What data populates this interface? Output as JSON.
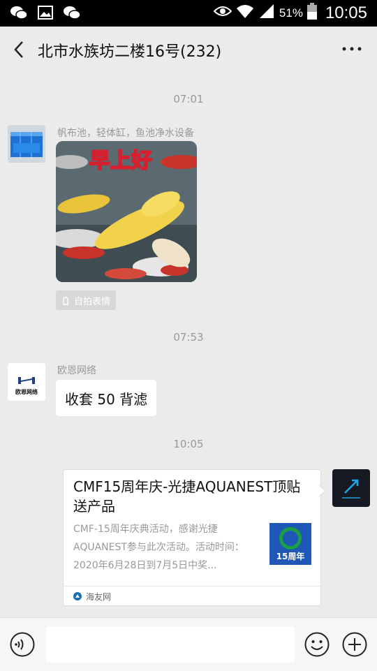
{
  "status_bar": {
    "battery_pct": "51%",
    "time": "10:05"
  },
  "header": {
    "title": "北市水族坊二楼16号(232)"
  },
  "messages": [
    {
      "time": "07:01"
    },
    {
      "sender": "帆布池，轻体缸，鱼池净水设备",
      "sticker_text": "早上好",
      "sticker_tag": "自拍表情"
    },
    {
      "time": "07:53"
    },
    {
      "sender": "欧恩网络",
      "avatar_text": "欧恩网络",
      "text": "收套 50 背滤"
    },
    {
      "time": "10:05"
    },
    {
      "card_title": "CMF15周年庆-光捷AQUANEST顶贴送产品",
      "card_desc": "CMF-15周年庆典活动，感谢光捷AQUANEST参与此次活动。活动时间：2020年6月28日到7月5日中奖...",
      "card_thumb_text": "15周年",
      "card_source": "海友网"
    }
  ],
  "colors": {
    "background": "#ebebeb",
    "bubble": "#ffffff",
    "meta_text": "#999999"
  }
}
